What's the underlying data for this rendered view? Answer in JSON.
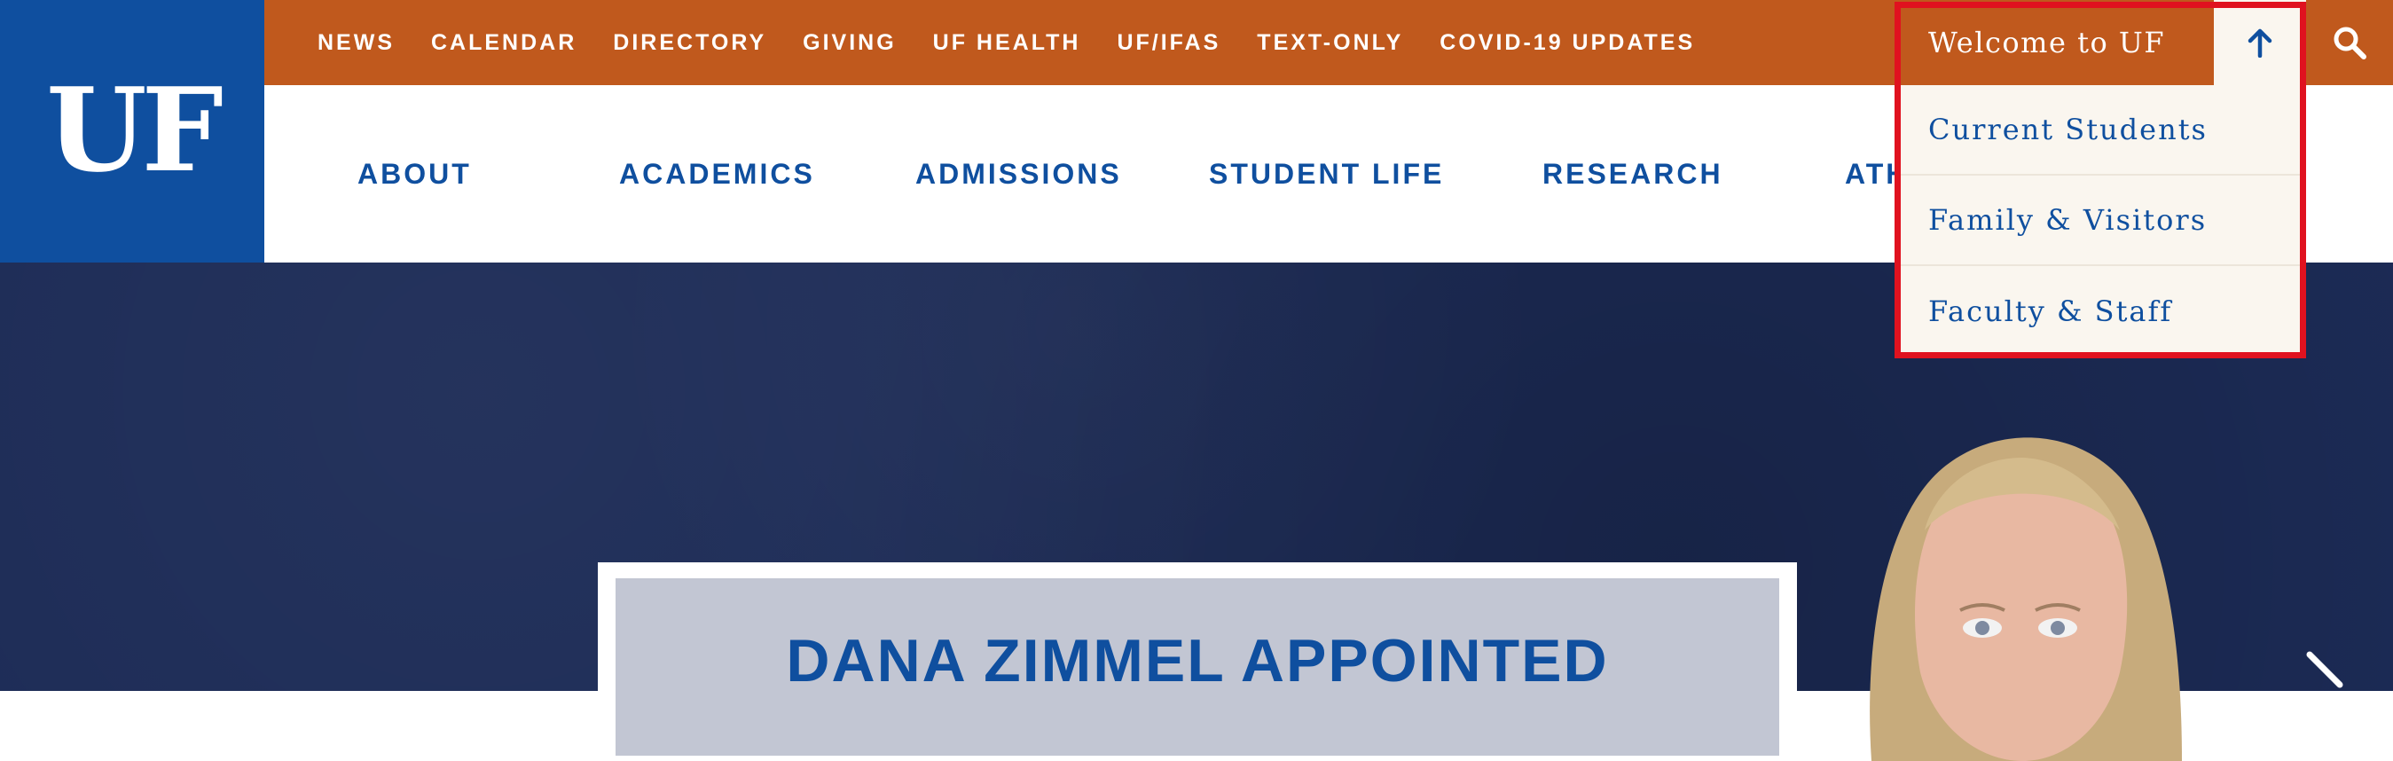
{
  "logo": {
    "text": "UF",
    "color": "#0F4F9F"
  },
  "topbar": {
    "color": "#C0591D",
    "links": [
      "NEWS",
      "CALENDAR",
      "DIRECTORY",
      "GIVING",
      "UF HEALTH",
      "UF/IFAS",
      "TEXT-ONLY",
      "COVID-19 UPDATES"
    ]
  },
  "mainnav": {
    "items": [
      "ABOUT",
      "ACADEMICS",
      "ADMISSIONS",
      "STUDENT LIFE",
      "RESEARCH",
      "ATH"
    ]
  },
  "welcome_menu": {
    "label": "Welcome to UF",
    "toggle_icon": "arrow-up-icon",
    "items": [
      "Current Students",
      "Family & Visitors",
      "Faculty & Staff"
    ],
    "highlight_color": "#E0121F"
  },
  "search": {
    "icon": "search-icon"
  },
  "hero": {
    "headline": "DANA ZIMMEL APPOINTED",
    "background_color": "#1C2B56",
    "next_icon": "chevron-right-icon"
  }
}
